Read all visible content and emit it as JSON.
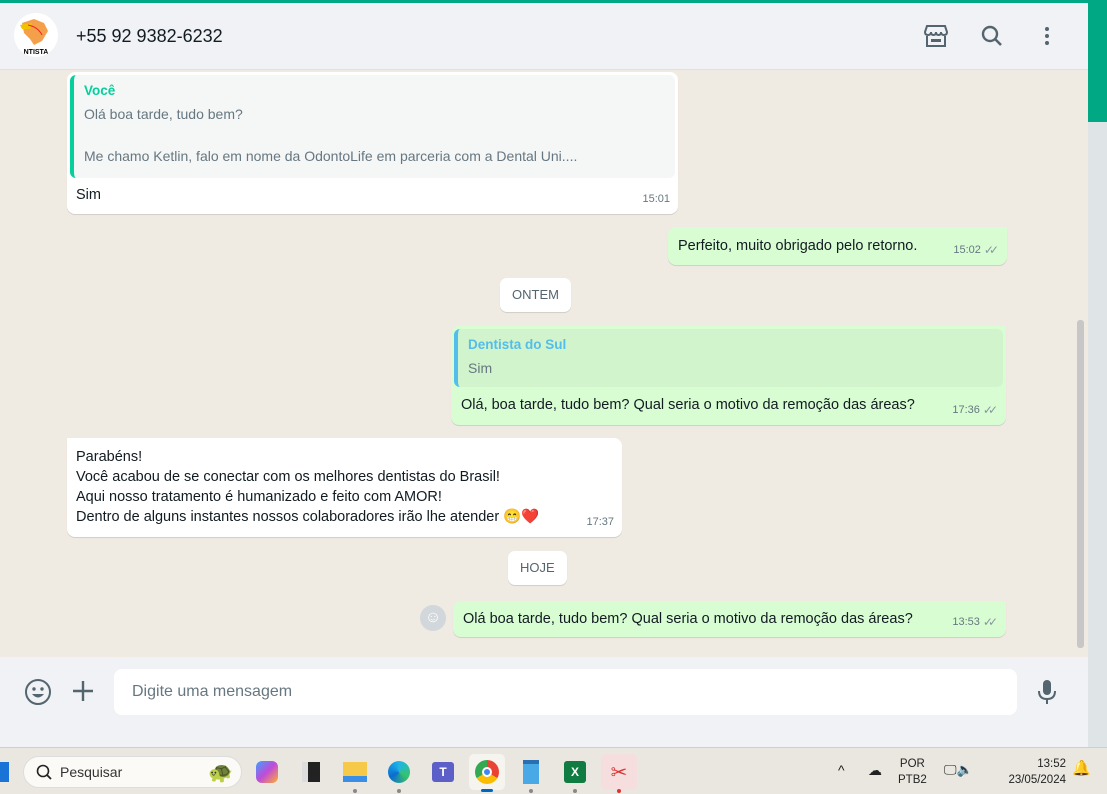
{
  "header": {
    "contact": "+55 92 9382-6232",
    "avatar_text": "NTISTA"
  },
  "messages": [
    {
      "dir": "in",
      "quote_author": "Você",
      "quote_line1": "Olá boa tarde, tudo bem?",
      "quote_line2": "Me chamo Ketlin, falo em nome da OdontoLife em parceria com a Dental Uni....",
      "text": "Sim",
      "time": "15:01"
    },
    {
      "dir": "out",
      "text": "Perfeito, muito obrigado pelo retorno.",
      "time": "15:02",
      "status": "read"
    },
    {
      "dir": "out",
      "quote_author": "Dentista do Sul",
      "quote_line1": "Sim",
      "text": "Olá, boa tarde, tudo bem? Qual seria o motivo da remoção das áreas?",
      "time": "17:36",
      "status": "read"
    },
    {
      "dir": "in",
      "lines": [
        "Parabéns!",
        "Você acabou de se conectar com os melhores dentistas do Brasil!",
        "Aqui nosso tratamento é humanizado e feito com AMOR!",
        "Dentro de alguns instantes nossos colaboradores irão lhe atender 😁❤️"
      ],
      "time": "17:37"
    },
    {
      "dir": "out",
      "text": "Olá boa tarde, tudo bem? Qual seria o motivo da remoção das áreas?",
      "time": "13:53",
      "status": "read"
    }
  ],
  "dates": [
    "ONTEM",
    "HOJE"
  ],
  "composer": {
    "placeholder": "Digite uma mensagem"
  },
  "taskbar": {
    "search_label": "Pesquisar",
    "lang1": "POR",
    "lang2": "PTB2",
    "time": "13:52",
    "date": "23/05/2024"
  },
  "colors": {
    "accent": "#00a884",
    "outgoing": "#d9fdd3",
    "incoming": "#ffffff",
    "quote_you": "#06cf9c",
    "quote_other": "#53bdeb"
  }
}
